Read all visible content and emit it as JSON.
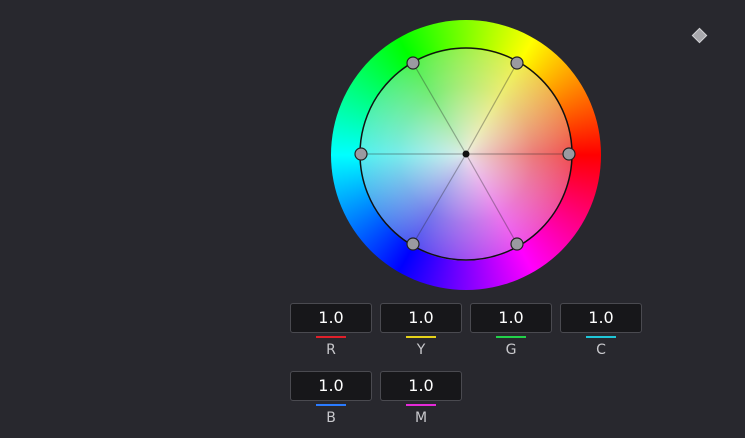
{
  "keyframe": {
    "icon": "diamond-icon"
  },
  "color_wheel": {
    "icon": "hue-wheel",
    "handles": [
      "red",
      "yellow",
      "green",
      "cyan",
      "blue",
      "magenta"
    ]
  },
  "channels": [
    {
      "key": "r",
      "label": "R",
      "value": "1.0",
      "color": "#e0202a"
    },
    {
      "key": "y",
      "label": "Y",
      "value": "1.0",
      "color": "#e6d21a"
    },
    {
      "key": "g",
      "label": "G",
      "value": "1.0",
      "color": "#22d24a"
    },
    {
      "key": "c",
      "label": "C",
      "value": "1.0",
      "color": "#1fc6d8"
    },
    {
      "key": "b",
      "label": "B",
      "value": "1.0",
      "color": "#2a7bff"
    },
    {
      "key": "m",
      "label": "M",
      "value": "1.0",
      "color": "#e52ad8"
    }
  ]
}
